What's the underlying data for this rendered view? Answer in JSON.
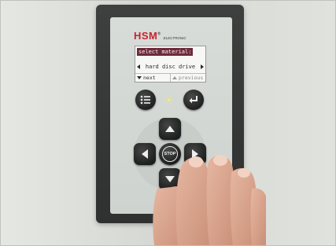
{
  "brand": {
    "name": "HSM",
    "reg": "®",
    "sub": "ELECTRONIC",
    "color": "#c8242b"
  },
  "display": {
    "title": "select material:",
    "value": "hard disc drive",
    "next_label": "next",
    "previous_label": "previous",
    "title_bg": "#6e2a3a"
  },
  "buttons": {
    "stop_label": "STOP",
    "menu_icon": "menu-list-icon",
    "enter_icon": "enter-return-icon",
    "up_icon": "arrow-up-icon",
    "down_icon": "arrow-down-icon",
    "left_icon": "arrow-left-icon",
    "right_icon": "arrow-right-icon"
  },
  "led": {
    "color": "#f6f2b5"
  }
}
